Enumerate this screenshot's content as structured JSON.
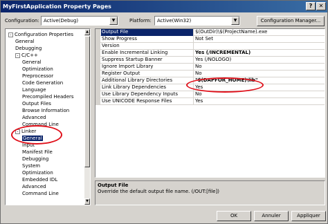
{
  "window": {
    "title": "MyFirstApplication Property Pages"
  },
  "toolbar": {
    "configuration_label": "Configuration:",
    "configuration_value": "Active(Debug)",
    "platform_label": "Platform:",
    "platform_value": "Active(Win32)",
    "config_manager_label": "Configuration Manager..."
  },
  "tree": {
    "items": [
      {
        "label": "Configuration Properties",
        "level": 0,
        "expander": "-"
      },
      {
        "label": "General",
        "level": 1
      },
      {
        "label": "Debugging",
        "level": 1
      },
      {
        "label": "C/C++",
        "level": 1,
        "expander": "-"
      },
      {
        "label": "General",
        "level": 2
      },
      {
        "label": "Optimization",
        "level": 2
      },
      {
        "label": "Preprocessor",
        "level": 2
      },
      {
        "label": "Code Generation",
        "level": 2
      },
      {
        "label": "Language",
        "level": 2
      },
      {
        "label": "Precompiled Headers",
        "level": 2
      },
      {
        "label": "Output Files",
        "level": 2
      },
      {
        "label": "Browse Information",
        "level": 2
      },
      {
        "label": "Advanced",
        "level": 2
      },
      {
        "label": "Command Line",
        "level": 2
      },
      {
        "label": "Linker",
        "level": 1,
        "expander": "-"
      },
      {
        "label": "General",
        "level": 2,
        "selected": true
      },
      {
        "label": "Input",
        "level": 2
      },
      {
        "label": "Manifest File",
        "level": 2
      },
      {
        "label": "Debugging",
        "level": 2
      },
      {
        "label": "System",
        "level": 2
      },
      {
        "label": "Optimization",
        "level": 2
      },
      {
        "label": "Embedded IDL",
        "level": 2
      },
      {
        "label": "Advanced",
        "level": 2
      },
      {
        "label": "Command Line",
        "level": 2
      }
    ]
  },
  "properties": [
    {
      "name": "Output File",
      "value": "$(OutDir)\\$(ProjectName).exe",
      "selected": true
    },
    {
      "name": "Show Progress",
      "value": "Not Set"
    },
    {
      "name": "Version",
      "value": ""
    },
    {
      "name": "Enable Incremental Linking",
      "value": "Yes (/INCREMENTAL)",
      "bold": true
    },
    {
      "name": "Suppress Startup Banner",
      "value": "Yes (/NOLOGO)"
    },
    {
      "name": "Ignore Import Library",
      "value": "No"
    },
    {
      "name": "Register Output",
      "value": "No"
    },
    {
      "name": "Additional Library Directories",
      "value": "\"$(DAPFOR_HOME)\\lib\"",
      "bold": true
    },
    {
      "name": "Link Library Dependencies",
      "value": "Yes"
    },
    {
      "name": "Use Library Dependency Inputs",
      "value": "No"
    },
    {
      "name": "Use UNICODE Response Files",
      "value": "Yes"
    }
  ],
  "description": {
    "title": "Output File",
    "text": "Override the default output file name.       (/OUT:[file])"
  },
  "buttons": {
    "ok": "OK",
    "cancel": "Annuler",
    "apply": "Appliquer"
  },
  "colors": {
    "highlight": "#0a246a",
    "annotation": "#e0101a"
  }
}
